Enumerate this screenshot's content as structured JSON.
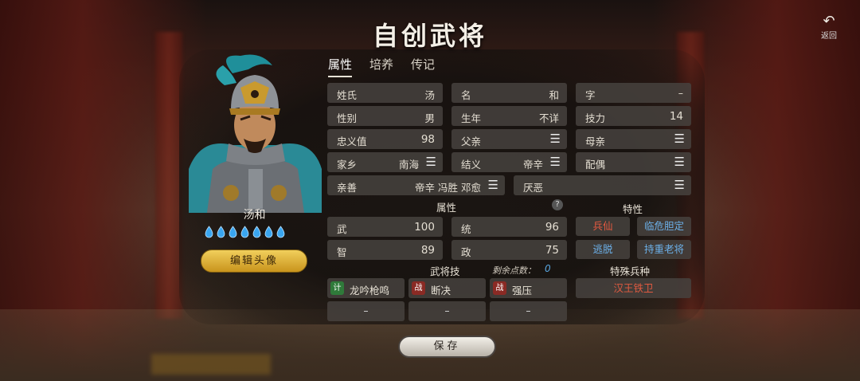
{
  "title": "自创武将",
  "back_label": "返回",
  "tabs": [
    "属性",
    "培养",
    "传记"
  ],
  "hero": {
    "name": "汤和",
    "gem_count": 7,
    "edit_portrait_label": "编辑头像"
  },
  "fields": {
    "surname": {
      "label": "姓氏",
      "value": "汤"
    },
    "given_name": {
      "label": "名",
      "value": "和"
    },
    "courtesy": {
      "label": "字",
      "value": "–"
    },
    "gender": {
      "label": "性别",
      "value": "男"
    },
    "birth_year": {
      "label": "生年",
      "value": "不详"
    },
    "skill_power": {
      "label": "技力",
      "value": "14"
    },
    "loyalty": {
      "label": "忠义值",
      "value": "98"
    },
    "father": {
      "label": "父亲"
    },
    "mother": {
      "label": "母亲"
    },
    "hometown": {
      "label": "家乡",
      "value": "南海"
    },
    "sworn": {
      "label": "结义",
      "value": "帝辛"
    },
    "spouse": {
      "label": "配偶"
    },
    "friendly": {
      "label": "亲善",
      "value": "帝辛 冯胜 邓愈"
    },
    "dislike": {
      "label": "厌恶"
    }
  },
  "attributes": {
    "title": "属性",
    "help": "?",
    "war": {
      "label": "武",
      "value": "100"
    },
    "command": {
      "label": "统",
      "value": "96"
    },
    "intellect": {
      "label": "智",
      "value": "89"
    },
    "politics": {
      "label": "政",
      "value": "75"
    }
  },
  "traits": {
    "title": "特性",
    "items": [
      "兵仙",
      "临危胆定",
      "逃脱",
      "持重老将"
    ]
  },
  "skills": {
    "title": "武将技",
    "points_label": "剩余点数：",
    "points_value": "0",
    "items": [
      {
        "badge": "计",
        "name": "龙吟枪鸣"
      },
      {
        "badge": "战",
        "name": "断决"
      },
      {
        "badge": "战",
        "name": "强压"
      }
    ],
    "empty": [
      "–",
      "–",
      "–"
    ]
  },
  "special_troop": {
    "title": "特殊兵种",
    "value": "汉王铁卫"
  },
  "save_label": "保存",
  "colors": {
    "accent_gold": "#e0b23a",
    "trait_red": "#e85a40",
    "trait_blue": "#6cb0e8"
  }
}
